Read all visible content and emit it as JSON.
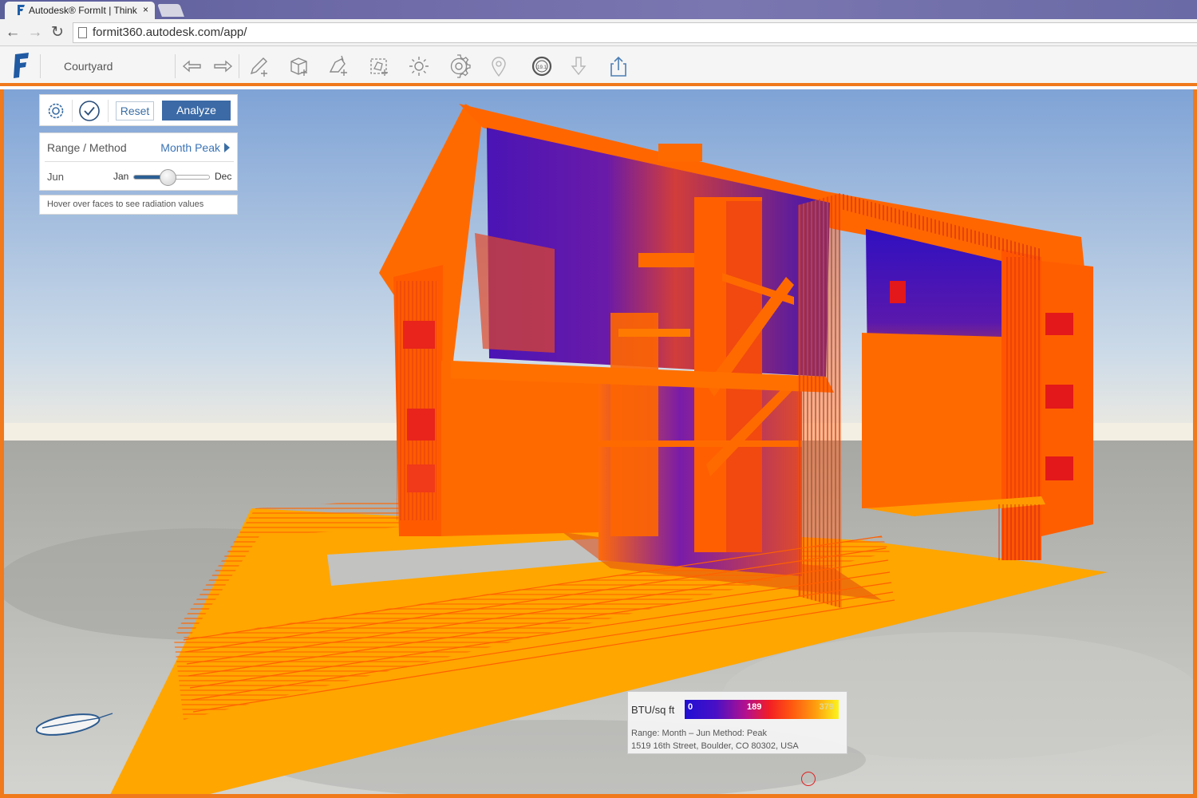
{
  "browser": {
    "tab_title": "Autodesk® FormIt | Think",
    "tab_close": "×",
    "url": "formit360.autodesk.com/app/"
  },
  "toolbar": {
    "file_name": "Courtyard",
    "tools": [
      "undo-icon",
      "redo-icon",
      "sketch-tool-icon",
      "cube-tool-icon",
      "add-object-icon",
      "group-tool-icon",
      "sun-icon",
      "gear-icon",
      "location-pin-icon",
      "solar-analysis-icon",
      "download-icon",
      "share-icon"
    ]
  },
  "panel": {
    "reset_label": "Reset",
    "analyze_label": "Analyze",
    "range_label": "Range / Method",
    "range_value": "Month Peak",
    "month_label": "Jun",
    "slider_start": "Jan",
    "slider_end": "Dec",
    "slider_value": 0.45,
    "hint": "Hover over faces to see radiation values"
  },
  "legend": {
    "unit": "BTU/sq ft",
    "min": "0",
    "mid": "189",
    "max": "379",
    "range_line": "Range:  Month – Jun    Method:  Peak",
    "address": "1519 16th Street, Boulder, CO 80302, USA"
  },
  "colors": {
    "accent": "#f07a1c",
    "primary_button": "#3b6aa6",
    "radiation_low": "#1f0fd4",
    "radiation_mid": "#f21e24",
    "radiation_high": "#fbf51a"
  }
}
